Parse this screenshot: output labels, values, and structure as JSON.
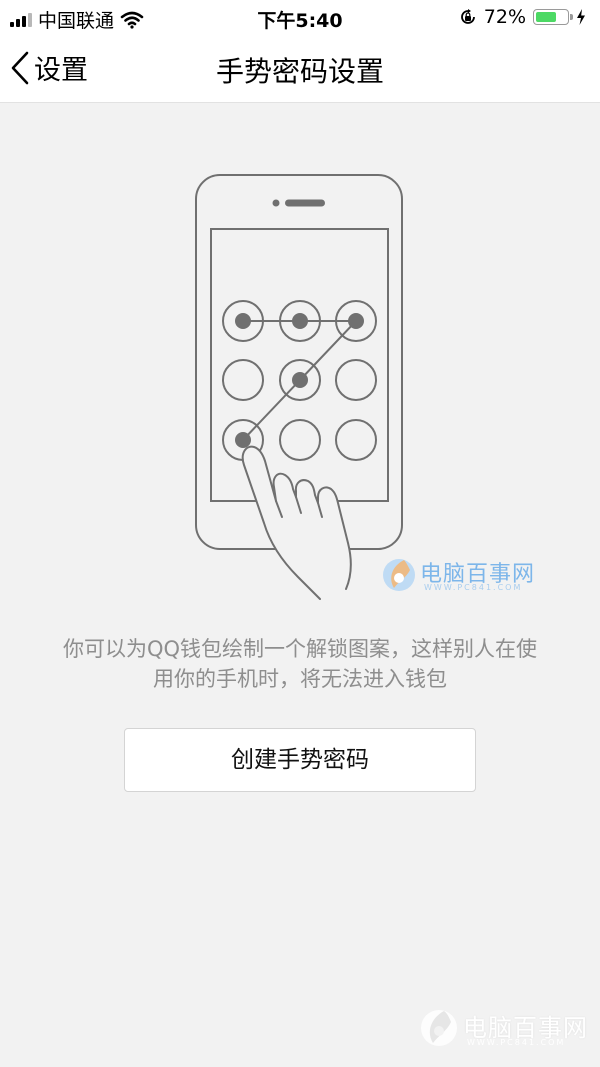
{
  "status_bar": {
    "carrier": "中国联通",
    "time": "下午5:40",
    "battery_percent": "72%",
    "battery_level": 0.72,
    "battery_color": "#4cd964"
  },
  "nav": {
    "back_label": "设置",
    "title": "手势密码设置"
  },
  "illustration": {
    "icon": "phone-gesture-pattern-illustration"
  },
  "watermark": {
    "brand": "电脑百事网",
    "url": "WWW.PC841.COM"
  },
  "main": {
    "hint_line1": "你可以为QQ钱包绘制一个解锁图案，这样别人在使",
    "hint_line2": "用你的手机时，将无法进入钱包",
    "create_button": "创建手势密码"
  },
  "colors": {
    "background": "#f2f2f2",
    "hint_text": "#8e8e8e",
    "illustration_stroke": "#707070"
  }
}
